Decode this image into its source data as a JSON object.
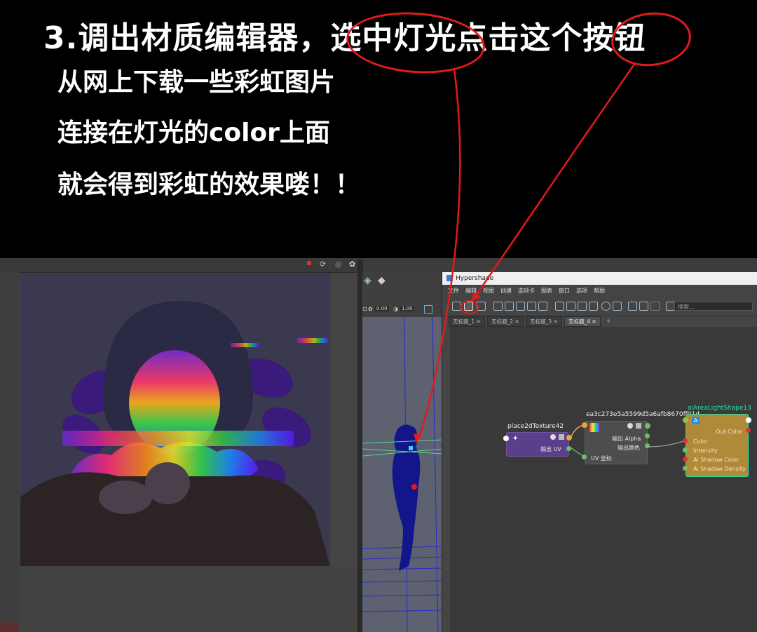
{
  "caption": {
    "title": "3.调出材质编辑器，选中灯光点击这个按钮",
    "lines": [
      "从网上下载一些彩虹图片",
      "连接在灯光的color上面",
      "就会得到彩虹的效果喽！！"
    ]
  },
  "viewport_toolbar": {
    "value_a": "0.00",
    "value_b": "1.00"
  },
  "hypershade": {
    "window_title": "Hypershade",
    "menu": [
      "文件",
      "编辑",
      "视图",
      "创建",
      "选项卡",
      "图表",
      "窗口",
      "选项",
      "帮助"
    ],
    "search_placeholder": "搜索...",
    "tabs": [
      {
        "label": "无标题_1",
        "close": "✕"
      },
      {
        "label": "无标题_2",
        "close": "✕"
      },
      {
        "label": "无标题_3",
        "close": "✕"
      },
      {
        "label": "无标题_4",
        "close": "✕"
      },
      {
        "label": "+"
      }
    ],
    "nodes": {
      "place2d": {
        "name": "place2dTexture42",
        "output": "输出 UV"
      },
      "file": {
        "name": "ea3c273e5a5599d5a6afb8670ff01d",
        "outputs": [
          "输出 Alpha",
          "输出颜色"
        ],
        "input": "UV 坐标"
      },
      "light": {
        "name": "aiAreaLightShape13",
        "output": "Out Color",
        "attrs": [
          "Color",
          "Intensity",
          "Ai Shadow Color",
          "Ai Shadow Density"
        ]
      }
    }
  },
  "colors": {
    "annotation_red": "#e31a1a",
    "light_node": "#b08a38",
    "place2d_node": "#5b3f8a",
    "file_node": "#4d4d4d",
    "light_label": "#22e3a5"
  }
}
